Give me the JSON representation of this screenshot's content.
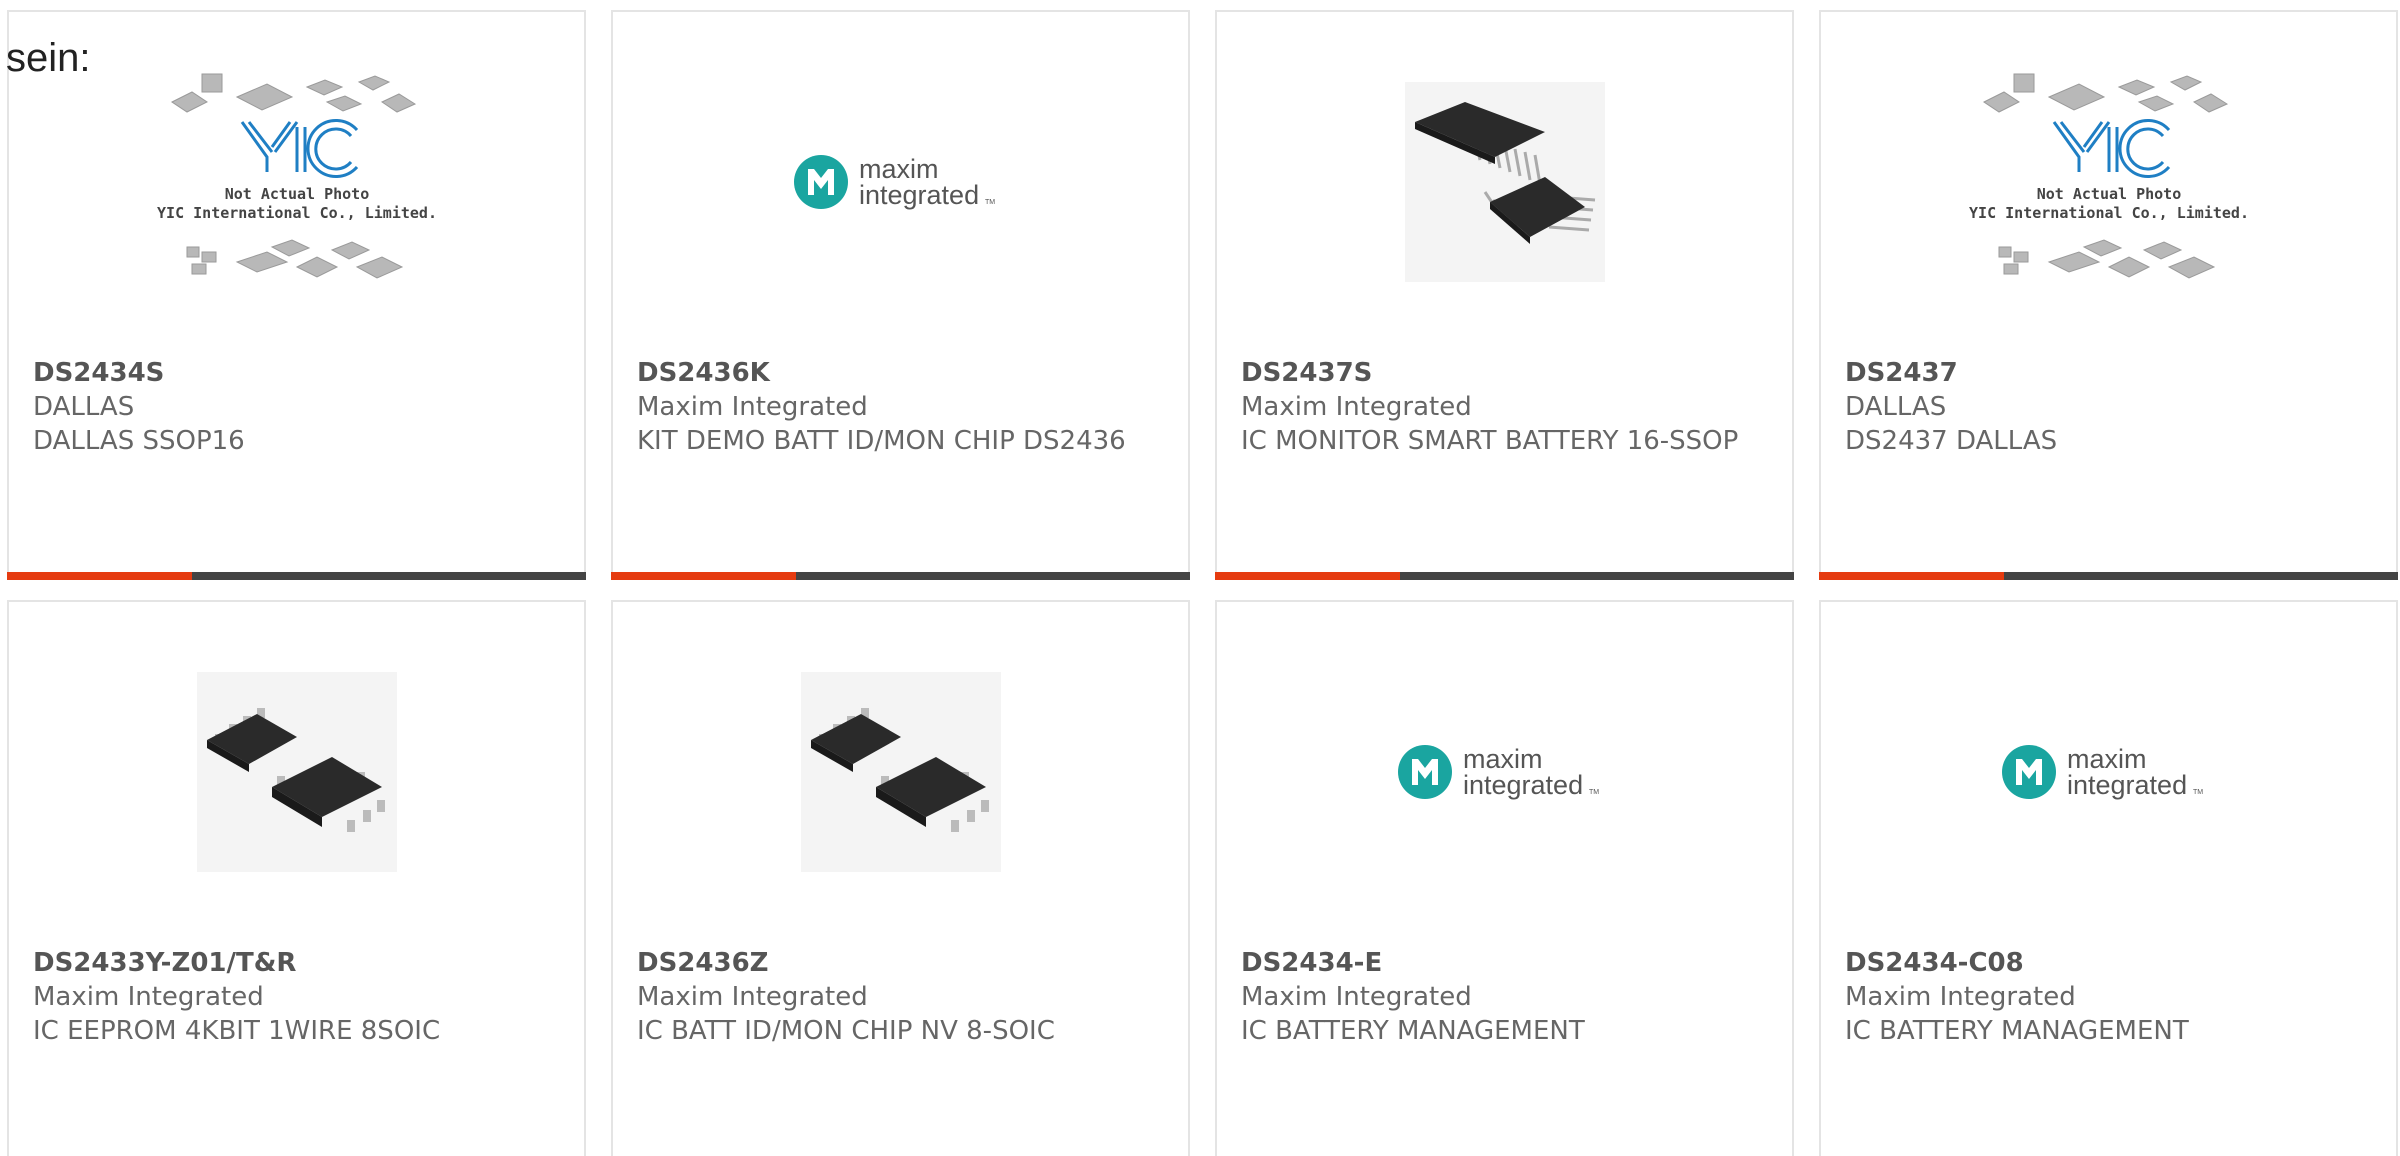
{
  "lead_text": "sein:",
  "placeholder_image": {
    "line1": "Not Actual Photo",
    "line2": "YIC International Co., Limited.",
    "logo": "YIC"
  },
  "maxim_logo": {
    "line1": "maxim",
    "line2": "integrated",
    "tm": "TM"
  },
  "colors": {
    "accent_bar": "#e53b10",
    "bar_track": "#444444",
    "maxim_teal": "#1aa5a0"
  },
  "products": [
    {
      "part_number": "DS2434S",
      "manufacturer": "DALLAS",
      "description": "DALLAS SSOP16",
      "image": "yic-placeholder",
      "progress_fraction": 0.32
    },
    {
      "part_number": "DS2436K",
      "manufacturer": "Maxim Integrated",
      "description": "KIT DEMO BATT ID/MON CHIP DS2436",
      "image": "maxim-logo",
      "progress_fraction": 0.32
    },
    {
      "part_number": "DS2437S",
      "manufacturer": "Maxim Integrated",
      "description": "IC MONITOR SMART BATTERY 16-SSOP",
      "image": "ssop16-chips",
      "progress_fraction": 0.32
    },
    {
      "part_number": "DS2437",
      "manufacturer": "DALLAS",
      "description": "DS2437 DALLAS",
      "image": "yic-placeholder",
      "progress_fraction": 0.32
    },
    {
      "part_number": "DS2433Y-Z01/T&R",
      "manufacturer": "Maxim Integrated",
      "description": "IC EEPROM 4KBIT 1WIRE 8SOIC",
      "image": "soic8-chips"
    },
    {
      "part_number": "DS2436Z",
      "manufacturer": "Maxim Integrated",
      "description": "IC BATT ID/MON CHIP NV 8-SOIC",
      "image": "soic8-chips"
    },
    {
      "part_number": "DS2434-E",
      "manufacturer": "Maxim Integrated",
      "description": "IC BATTERY MANAGEMENT",
      "image": "maxim-logo"
    },
    {
      "part_number": "DS2434-C08",
      "manufacturer": "Maxim Integrated",
      "description": "IC BATTERY MANAGEMENT",
      "image": "maxim-logo"
    }
  ]
}
